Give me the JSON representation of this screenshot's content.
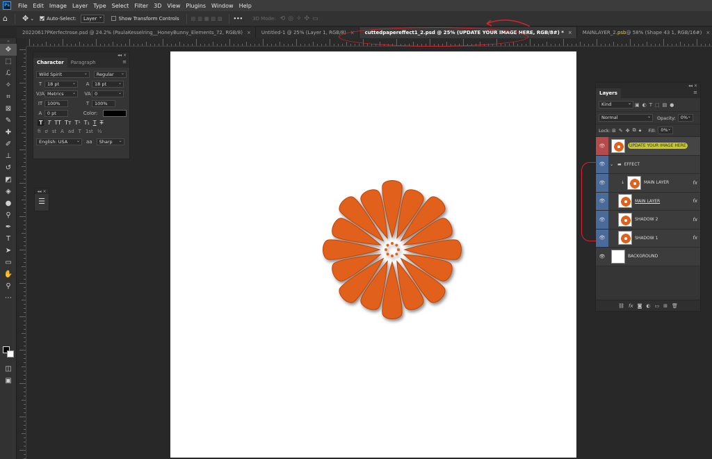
{
  "menu": [
    "File",
    "Edit",
    "Image",
    "Layer",
    "Type",
    "Select",
    "Filter",
    "3D",
    "View",
    "Plugins",
    "Window",
    "Help"
  ],
  "app_logo": "Ps",
  "options": {
    "auto_select_label": "Auto-Select:",
    "auto_select_value": "Layer",
    "show_transform_label": "Show Transform Controls",
    "more": "•••",
    "mode_3d": "3D Mode:"
  },
  "tabs": [
    {
      "label": "20220617PKerfectrose.psd @ 24.2% (PaulaKesselring__HoneyBunny_Elements_72, RGB/8)",
      "close": "×"
    },
    {
      "label": "Untitled-1 @ 25% (Layer 1, RGB/8)",
      "close": "×"
    },
    {
      "label": "cuttedpapereffect1_2.psd @ 25% (UPDATE YOUR IMAGE HERE, RGB/8#) *",
      "close": "×"
    },
    {
      "label_pre": "MAINLAYER_2",
      "label_accent": ".psb",
      "label_post": " @ 58% (Shape 43 1, RGB/16#)",
      "close": "×"
    }
  ],
  "character": {
    "tab_character": "Character",
    "tab_paragraph": "Paragraph",
    "font_family": "Wild Spirit",
    "font_style": "Regular",
    "font_size": "18 pt",
    "leading": "18 pt",
    "kerning": "Metrics",
    "tracking": "0",
    "vscale": "100%",
    "hscale": "100%",
    "baseline": "0 pt",
    "color_label": "Color:",
    "language": "English: USA",
    "aa_icon": "aa",
    "antialias": "Sharp",
    "style_buttons": [
      "T",
      "T",
      "TT",
      "Tт",
      "T¹",
      "T₁",
      "T",
      "T"
    ],
    "opentype_buttons": [
      "fi",
      "ơ",
      "st",
      "A",
      "ad",
      "T",
      "1st",
      "½"
    ]
  },
  "layers": {
    "title": "Layers",
    "kind": "Kind",
    "blend_mode": "Normal",
    "opacity_label": "Opacity:",
    "opacity": "0%",
    "lock_label": "Lock:",
    "fill_label": "Fill:",
    "fill": "0%",
    "items": [
      {
        "name": "UPDATE YOUR IMAGE HERE",
        "fx": ""
      },
      {
        "name": "EFFECT",
        "fx": ""
      },
      {
        "name": "MAIN LAYER",
        "fx": "fx"
      },
      {
        "name": "MAIN LAYER",
        "fx": "fx"
      },
      {
        "name": "SHADOW 2",
        "fx": "fx"
      },
      {
        "name": "SHADOW 1",
        "fx": "fx"
      },
      {
        "name": "BACKGROUND",
        "fx": ""
      }
    ],
    "footer": [
      "⛓",
      "fx",
      "◙",
      "◐",
      "▭",
      "⊞",
      "🗑"
    ]
  },
  "colors": {
    "flower": "#e0601c",
    "annotation": "#d9232e",
    "highlight": "#c8c82a"
  }
}
